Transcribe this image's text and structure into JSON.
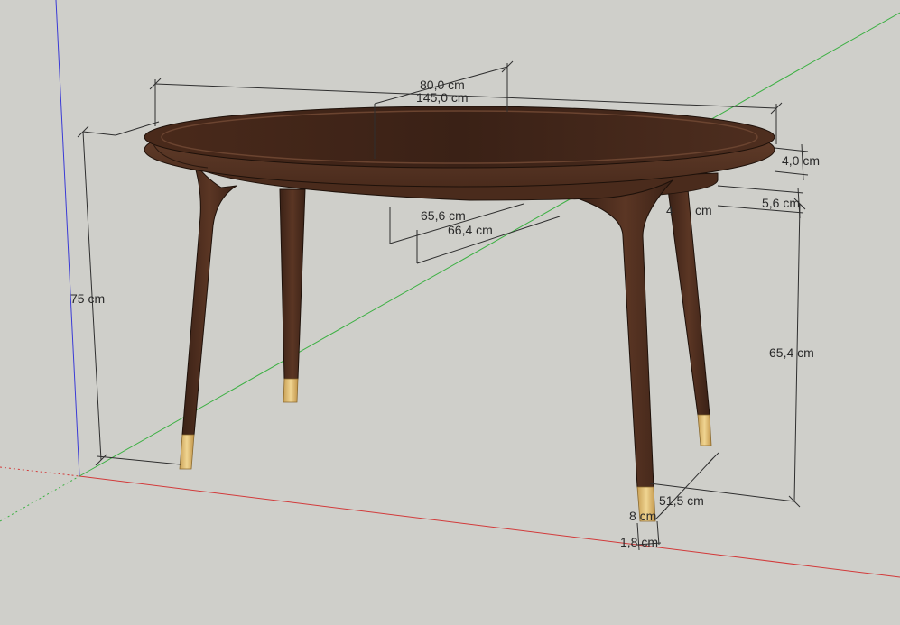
{
  "colors": {
    "background": "#cfcfca",
    "axis_red": "#d23a3a",
    "axis_green": "#3cb043",
    "axis_blue": "#3b3bd6",
    "wood_dark": "#3d2418",
    "wood_mid": "#5a3626",
    "brass": "#d8b46a",
    "dimension_line": "#2f2f2f"
  },
  "dimensions": {
    "width_short": "80,0 cm",
    "length": "145,0 cm",
    "top_thickness": "4,0 cm",
    "apron_offset": "5,6 cm",
    "apron_partial": "cm",
    "apron_partial_num": "4",
    "inner_width_1": "65,6 cm",
    "inner_width_2": "66,4 cm",
    "total_height": "75 cm",
    "leg_height": "65,4 cm",
    "leg_spread": "51,5 cm",
    "foot_size": "8 cm",
    "foot_width": "1,8 cm"
  }
}
